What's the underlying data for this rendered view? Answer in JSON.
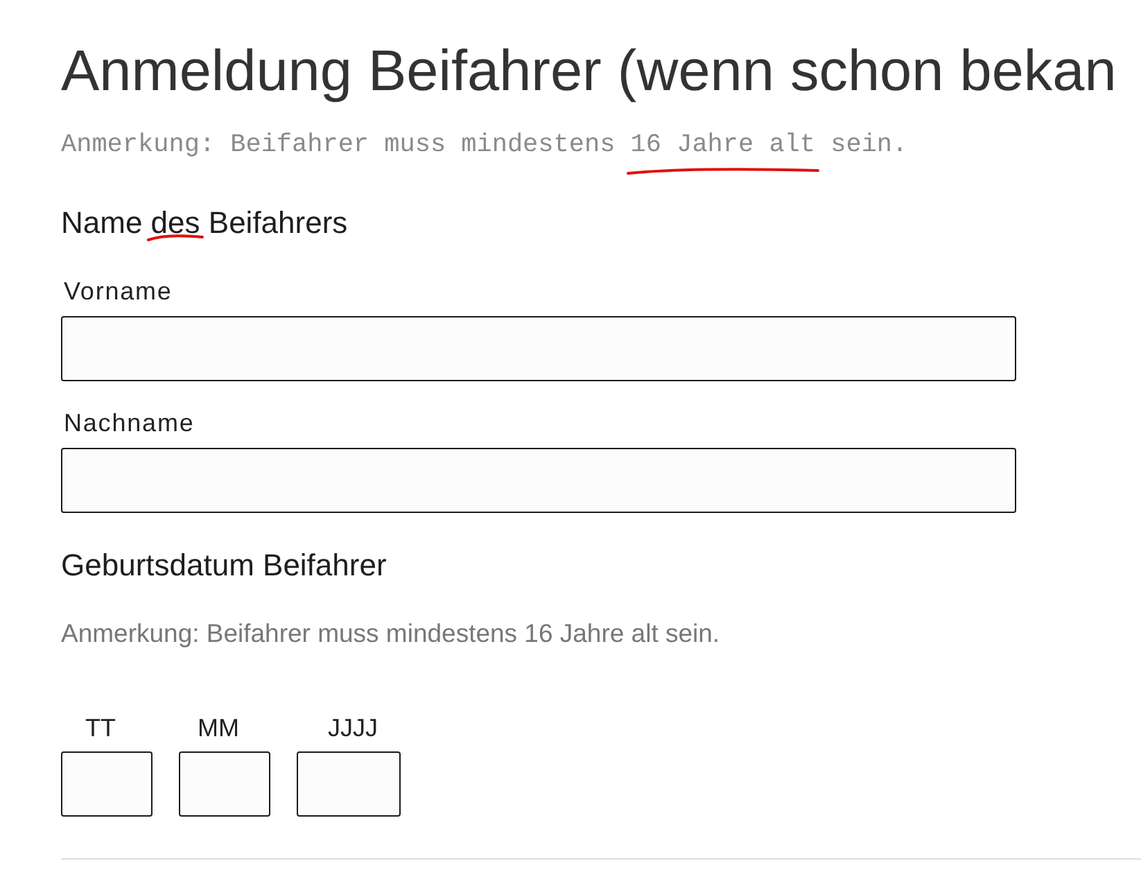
{
  "page_title": "Anmeldung Beifahrer (wenn schon bekan",
  "top_note": {
    "parts": [
      {
        "text": "Anmerkung: Beifahrer muss mindestens ",
        "marked": false
      },
      {
        "text": "16 Jahre alt",
        "marked": true
      },
      {
        "text": " sein.",
        "marked": false
      }
    ]
  },
  "name_section": {
    "heading": {
      "parts": [
        {
          "text": "Name ",
          "marked": false
        },
        {
          "text": "des",
          "marked": true
        },
        {
          "text": " Beifahrers",
          "marked": false
        }
      ]
    },
    "fields": [
      {
        "label": "Vorname"
      },
      {
        "label": "Nachname"
      }
    ]
  },
  "birthdate_section": {
    "heading": "Geburtsdatum Beifahrer",
    "note": "Anmerkung: Beifahrer muss mindestens 16 Jahre alt sein.",
    "fields": [
      {
        "label": "TT"
      },
      {
        "label": "MM"
      },
      {
        "label": "JJJJ"
      }
    ]
  }
}
